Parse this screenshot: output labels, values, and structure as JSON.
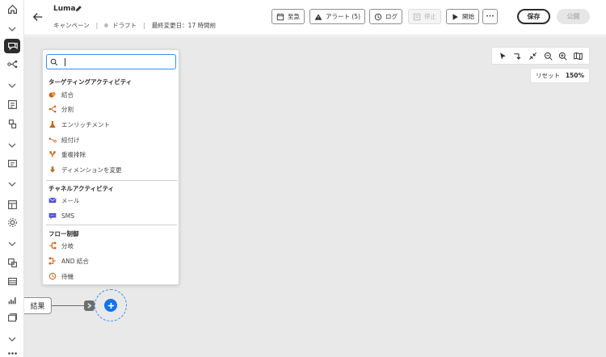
{
  "header": {
    "title": "Luma",
    "type": "キャンペーン",
    "status": "ドラフト",
    "last_modified": "最終変更日：17 時間前"
  },
  "toolbar_buttons": {
    "schedule": "至急",
    "alerts": "アラート (5)",
    "log": "ログ",
    "stop": "停止",
    "start": "開始",
    "more": "•••",
    "save": "保存",
    "publish": "公開"
  },
  "canvas_tools": {
    "reset": "リセット",
    "zoom": "150%"
  },
  "panel": {
    "search_value": "",
    "sections": [
      {
        "title": "ターゲティングアクティビティ",
        "items": [
          {
            "label": "結合",
            "icon": "combine-icon"
          },
          {
            "label": "分割",
            "icon": "split-icon"
          },
          {
            "label": "エンリッチメント",
            "icon": "enrichment-icon"
          },
          {
            "label": "紐付け",
            "icon": "reconciliation-icon"
          },
          {
            "label": "重複排除",
            "icon": "deduplication-icon"
          },
          {
            "label": "ディメンションを変更",
            "icon": "change-dimension-icon"
          }
        ]
      },
      {
        "title": "チャネルアクティビティ",
        "items": [
          {
            "label": "メール",
            "icon": "email-icon"
          },
          {
            "label": "SMS",
            "icon": "sms-icon"
          }
        ]
      },
      {
        "title": "フロー制御",
        "items": [
          {
            "label": "分岐",
            "icon": "fork-icon"
          },
          {
            "label": "AND 結合",
            "icon": "and-join-icon"
          },
          {
            "label": "待機",
            "icon": "wait-icon"
          }
        ]
      }
    ]
  },
  "node": {
    "label": "結果"
  },
  "colors": {
    "accent": "#1473e6",
    "activity": "#c4661f",
    "channel": "#5151d3"
  }
}
